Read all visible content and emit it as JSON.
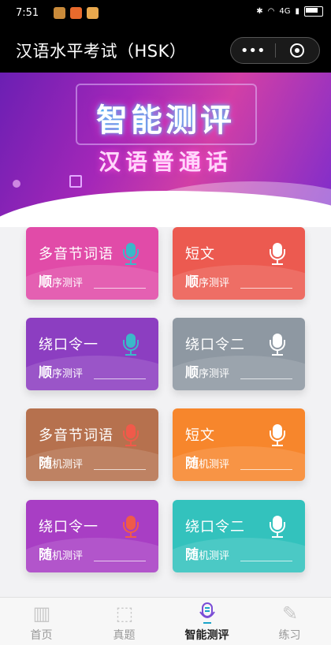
{
  "status_bar": {
    "time": "7:51",
    "network": "4G"
  },
  "nav": {
    "title": "汉语水平考试（HSK）",
    "more_icon": "more-dots-icon",
    "close_icon": "mini-program-close-icon"
  },
  "banner": {
    "title": "智能测评",
    "subtitle": "汉语普通话"
  },
  "cards": [
    {
      "title": "多音节词语",
      "mode_big": "顺",
      "mode_small": "序测评",
      "color": "#e14ba8",
      "mic_color": "#3bb8c9"
    },
    {
      "title": "短文",
      "mode_big": "顺",
      "mode_small": "序测评",
      "color": "#ec5a50",
      "mic_color": "#ffffff"
    },
    {
      "title": "绕口令一",
      "mode_big": "顺",
      "mode_small": "序测评",
      "color": "#8c3ec1",
      "mic_color": "#3bb8c9"
    },
    {
      "title": "绕口令二",
      "mode_big": "顺",
      "mode_small": "序测评",
      "color": "#8e98a2",
      "mic_color": "#ffffff"
    },
    {
      "title": "多音节词语",
      "mode_big": "随",
      "mode_small": "机测评",
      "color": "#b6714e",
      "mic_color": "#f05a4a"
    },
    {
      "title": "短文",
      "mode_big": "随",
      "mode_small": "机测评",
      "color": "#f7862c",
      "mic_color": "#ffffff"
    },
    {
      "title": "绕口令一",
      "mode_big": "随",
      "mode_small": "机测评",
      "color": "#a83ec4",
      "mic_color": "#f05a4a"
    },
    {
      "title": "绕口令二",
      "mode_big": "随",
      "mode_small": "机测评",
      "color": "#33c2bd",
      "mic_color": "#ffffff"
    }
  ],
  "tabs": [
    {
      "label": "首页",
      "icon": "building-icon"
    },
    {
      "label": "真题",
      "icon": "chart-icon"
    },
    {
      "label": "智能测评",
      "icon": "microphone-icon",
      "active": true
    },
    {
      "label": "练习",
      "icon": "pencil-icon"
    }
  ]
}
